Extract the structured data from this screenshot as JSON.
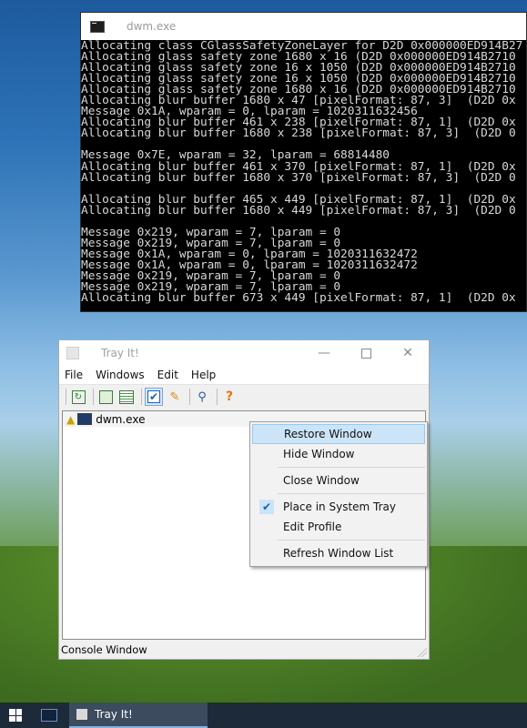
{
  "console": {
    "title": "dwm.exe",
    "lines": [
      "Allocating class CGlassSafetyZoneLayer for D2D 0x000000ED914B27",
      "Allocating glass safety zone 1680 x 16 (D2D 0x000000ED914B2710",
      "Allocating glass safety zone 16 x 1050 (D2D 0x000000ED914B2710",
      "Allocating glass safety zone 16 x 1050 (D2D 0x000000ED914B2710",
      "Allocating glass safety zone 1680 x 16 (D2D 0x000000ED914B2710",
      "Allocating blur buffer 1680 x 47 [pixelFormat: 87, 3]  (D2D 0x",
      "Message 0x1A, wparam = 0, lparam = 1020311632456",
      "Allocating blur buffer 461 x 238 [pixelFormat: 87, 1]  (D2D 0x",
      "Allocating blur buffer 1680 x 238 [pixelFormat: 87, 3]  (D2D 0",
      "",
      "Message 0x7E, wparam = 32, lparam = 68814480",
      "Allocating blur buffer 461 x 370 [pixelFormat: 87, 1]  (D2D 0x",
      "Allocating blur buffer 1680 x 370 [pixelFormat: 87, 3]  (D2D 0",
      "",
      "Allocating blur buffer 465 x 449 [pixelFormat: 87, 1]  (D2D 0x",
      "Allocating blur buffer 1680 x 449 [pixelFormat: 87, 3]  (D2D 0",
      "",
      "Message 0x219, wparam = 7, lparam = 0",
      "Message 0x219, wparam = 7, lparam = 0",
      "Message 0x1A, wparam = 0, lparam = 1020311632472",
      "Message 0x1A, wparam = 0, lparam = 1020311632472",
      "Message 0x219, wparam = 7, lparam = 0",
      "Message 0x219, wparam = 7, lparam = 0",
      "Allocating blur buffer 673 x 449 [pixelFormat: 87, 1]  (D2D 0x"
    ]
  },
  "trayit": {
    "title": "Tray It!",
    "menus": [
      "File",
      "Windows",
      "Edit",
      "Help"
    ],
    "toolbar_icons": [
      "refresh-icon",
      "window-settings-icon",
      "window-list-icon",
      "tray-check-icon",
      "edit-profile-icon",
      "search-icon",
      "help-icon"
    ],
    "list_items": [
      {
        "label": "dwm.exe"
      }
    ],
    "status": "Console Window"
  },
  "context_menu": {
    "items": {
      "restore": "Restore Window",
      "hide": "Hide Window",
      "close": "Close Window",
      "tray": "Place in System Tray",
      "edit": "Edit Profile",
      "refresh": "Refresh Window List"
    },
    "tray_checked": true
  },
  "taskbar": {
    "task_label": "Tray It!"
  }
}
